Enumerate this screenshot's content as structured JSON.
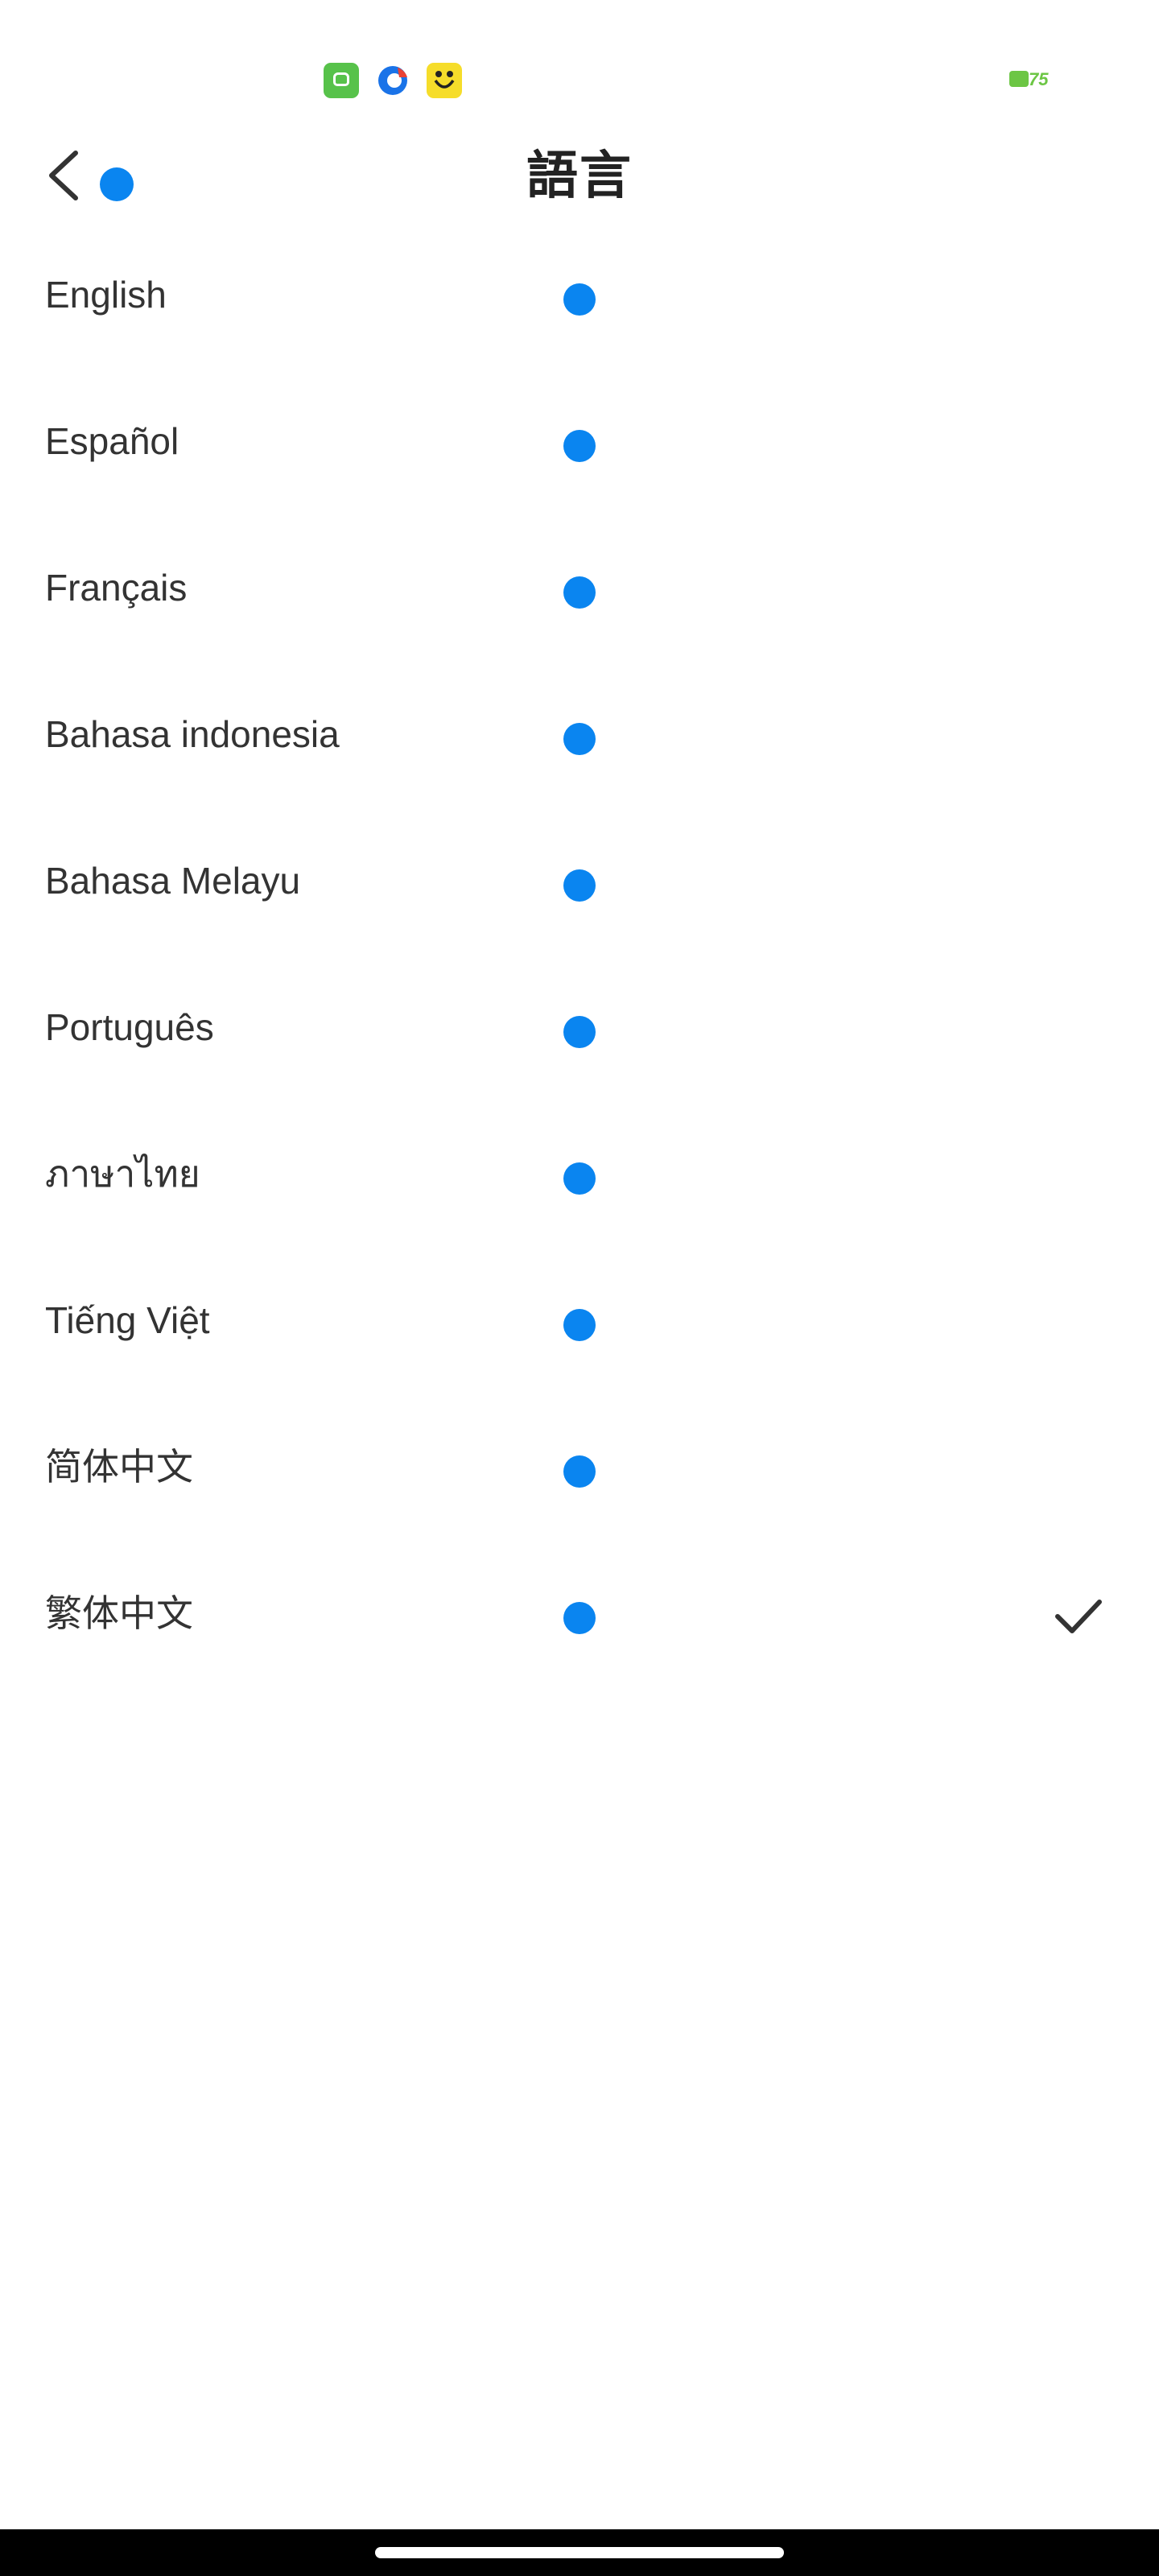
{
  "status_bar": {
    "notification_icons": [
      "android-app-icon",
      "browser-icon",
      "smiley-app-icon"
    ],
    "battery_level": "75",
    "battery_color": "#6cc644"
  },
  "header": {
    "title": "語言",
    "back_icon": "chevron-left-icon"
  },
  "languages": [
    {
      "label": "English",
      "selected": false
    },
    {
      "label": "Español",
      "selected": false
    },
    {
      "label": "Français",
      "selected": false
    },
    {
      "label": "Bahasa indonesia",
      "selected": false
    },
    {
      "label": "Bahasa Melayu",
      "selected": false
    },
    {
      "label": "Português",
      "selected": false
    },
    {
      "label": "ภาษาไทย",
      "selected": false
    },
    {
      "label": "Tiếng Việt",
      "selected": false
    },
    {
      "label": "简体中文",
      "selected": false
    },
    {
      "label": "繁体中文",
      "selected": true
    }
  ],
  "colors": {
    "accent_dot": "#0a85f0",
    "text": "#333333",
    "background": "#ffffff"
  },
  "icons": {
    "selected": "checkmark-icon"
  }
}
